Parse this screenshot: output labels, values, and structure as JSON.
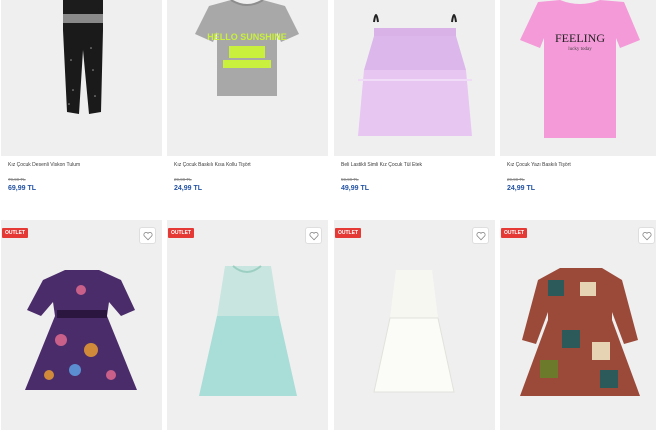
{
  "products_top": [
    {
      "name": "Kız Çocuk Desenli Viskon Tulum",
      "old_price": "79,99 TL",
      "price": "69,99 TL"
    },
    {
      "name": "Kız Çocuk Baskılı Kısa Kollu Tişört",
      "old_price": "29,99 TL",
      "price": "24,99 TL"
    },
    {
      "name": "Beli Lastikli Simli Kız Çocuk Tül Etek",
      "old_price": "59,99 TL",
      "price": "49,99 TL"
    },
    {
      "name": "Kız Çocuk Yazı Baskılı Tişört",
      "old_price": "29,99 TL",
      "price": "24,99 TL"
    }
  ],
  "products_bottom": [
    {
      "badge": "OUTLET",
      "favorite": "heart-icon"
    },
    {
      "badge": "OUTLET",
      "favorite": "heart-icon"
    },
    {
      "badge": "OUTLET",
      "favorite": "heart-icon"
    },
    {
      "badge": "OUTLET",
      "favorite": "heart-icon"
    }
  ],
  "tee_prints": {
    "green": "HELLO SUNSHINE",
    "pink": "FEELING",
    "pink_sub": "lucky today"
  },
  "colors": {
    "price": "#2453a4",
    "badge": "#e53935",
    "image_bg": "#efefef"
  }
}
